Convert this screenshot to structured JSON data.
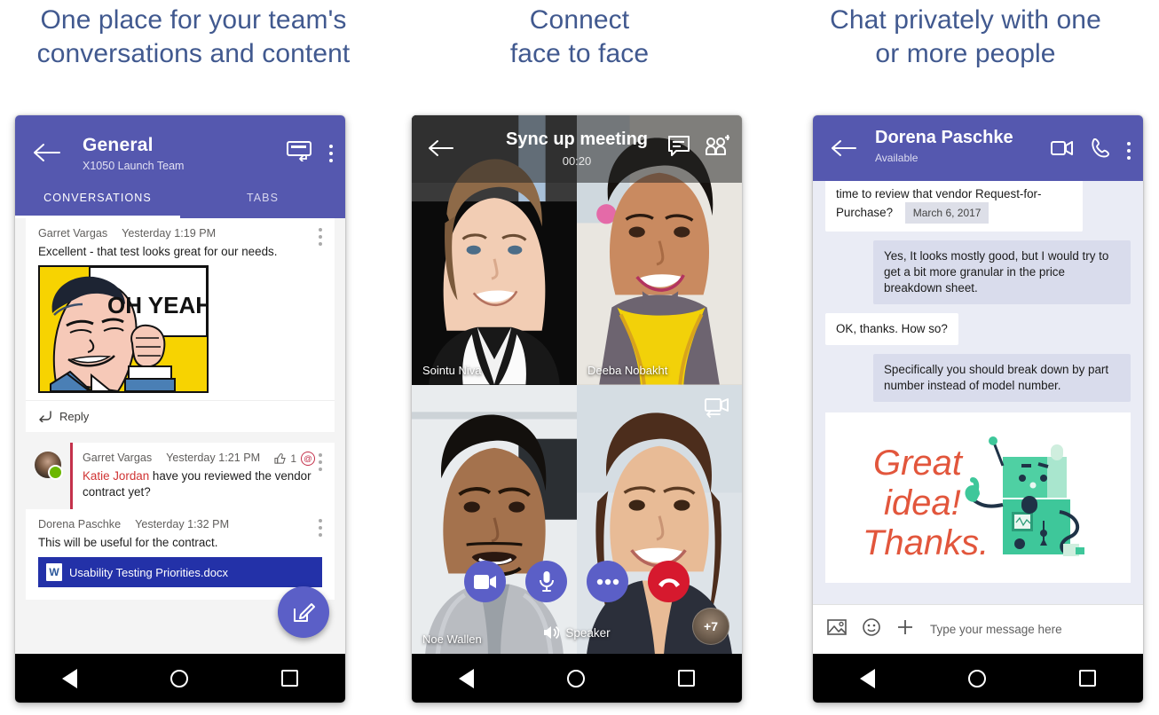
{
  "panels": [
    {
      "headline_line1": "One place for your team's",
      "headline_line2": "conversations and content",
      "app": {
        "header": {
          "title": "General",
          "subtitle": "X1050 Launch Team",
          "back_icon": "back-arrow-icon",
          "reply_icon": "reply-card-icon",
          "overflow_icon": "overflow-kebab-icon"
        },
        "tabs": [
          {
            "label": "CONVERSATIONS",
            "active": true
          },
          {
            "label": "TABS",
            "active": false
          }
        ],
        "messages": [
          {
            "author": "Garret Vargas",
            "timestamp": "Yesterday 1:19 PM",
            "text": "Excellent - that test looks great for our needs.",
            "attachment_type": "comic-image",
            "attachment_text": "OH YEAH!"
          },
          {
            "author": "Garret Vargas",
            "timestamp": "Yesterday 1:21 PM",
            "mention": "Katie Jordan",
            "text": " have you reviewed the vendor contract yet?",
            "like_count": "1",
            "mention_badge": "@"
          },
          {
            "author": "Dorena Paschke",
            "timestamp": "Yesterday 1:32 PM",
            "text": "This will be useful for the contract.",
            "file_name": "Usability Testing  Priorities.docx",
            "file_icon_letter": "W"
          }
        ],
        "reply_label": "Reply",
        "compose_fab_icon": "compose-pencil-icon"
      }
    },
    {
      "headline_line1": "Connect",
      "headline_line2": "face to face",
      "call": {
        "title": "Sync up meeting",
        "elapsed": "00:20",
        "back_icon": "back-arrow-icon",
        "chat_icon": "chat-bubble-icon",
        "add_people_icon": "add-participant-icon",
        "switch_camera_icon": "switch-camera-icon",
        "participants": [
          {
            "name": "Sointu Niva"
          },
          {
            "name": "Deeba Nobakht"
          },
          {
            "name": "Noe Wallen"
          },
          {
            "name": ""
          }
        ],
        "controls": [
          {
            "icon": "video-camera-icon",
            "style": "purple"
          },
          {
            "icon": "microphone-icon",
            "style": "purple"
          },
          {
            "icon": "more-dots-icon",
            "style": "purple"
          },
          {
            "icon": "hang-up-icon",
            "style": "red"
          }
        ],
        "speaker_label": "Speaker",
        "speaker_icon": "speaker-icon",
        "overflow_count": "+7"
      }
    },
    {
      "headline_line1": "Chat privately with one",
      "headline_line2": "or more people",
      "chat": {
        "header": {
          "title": "Dorena Paschke",
          "status": "Available",
          "back_icon": "back-arrow-icon",
          "video_icon": "video-call-icon",
          "phone_icon": "phone-call-icon",
          "overflow_icon": "overflow-kebab-icon"
        },
        "messages": [
          {
            "side": "them",
            "text": "time to review that vendor Request-for-Purchase?",
            "date_pill": "March 6, 2017",
            "clipped": true
          },
          {
            "side": "me",
            "text": "Yes, It looks mostly good, but I would try to get a bit more granular in the price breakdown sheet."
          },
          {
            "side": "them",
            "text": "OK, thanks. How so?"
          },
          {
            "side": "me",
            "text": "Specifically you should break down by part number instead of model number."
          },
          {
            "side": "card",
            "image_text_line1": "Great",
            "image_text_line2": "idea!",
            "image_text_line3": "Thanks.",
            "image_alt": "robot-thumbs-up-sticker"
          }
        ],
        "compose": {
          "placeholder": "Type your message here",
          "image_icon": "image-picker-icon",
          "emoji_icon": "emoji-icon",
          "plus_icon": "plus-attach-icon"
        }
      }
    }
  ],
  "navbar": {
    "back_icon": "android-back-icon",
    "home_icon": "android-home-icon",
    "recents_icon": "android-recents-icon"
  },
  "colors": {
    "headline": "#41598f",
    "teams_purple": "#5558af",
    "accent_purple": "#5b5fc7",
    "hangup_red": "#d6192e",
    "chat_bg": "#eaecf5",
    "bubble_me": "#d9dcec",
    "mention_red": "#c4314b",
    "file_chip": "#2331a8"
  }
}
